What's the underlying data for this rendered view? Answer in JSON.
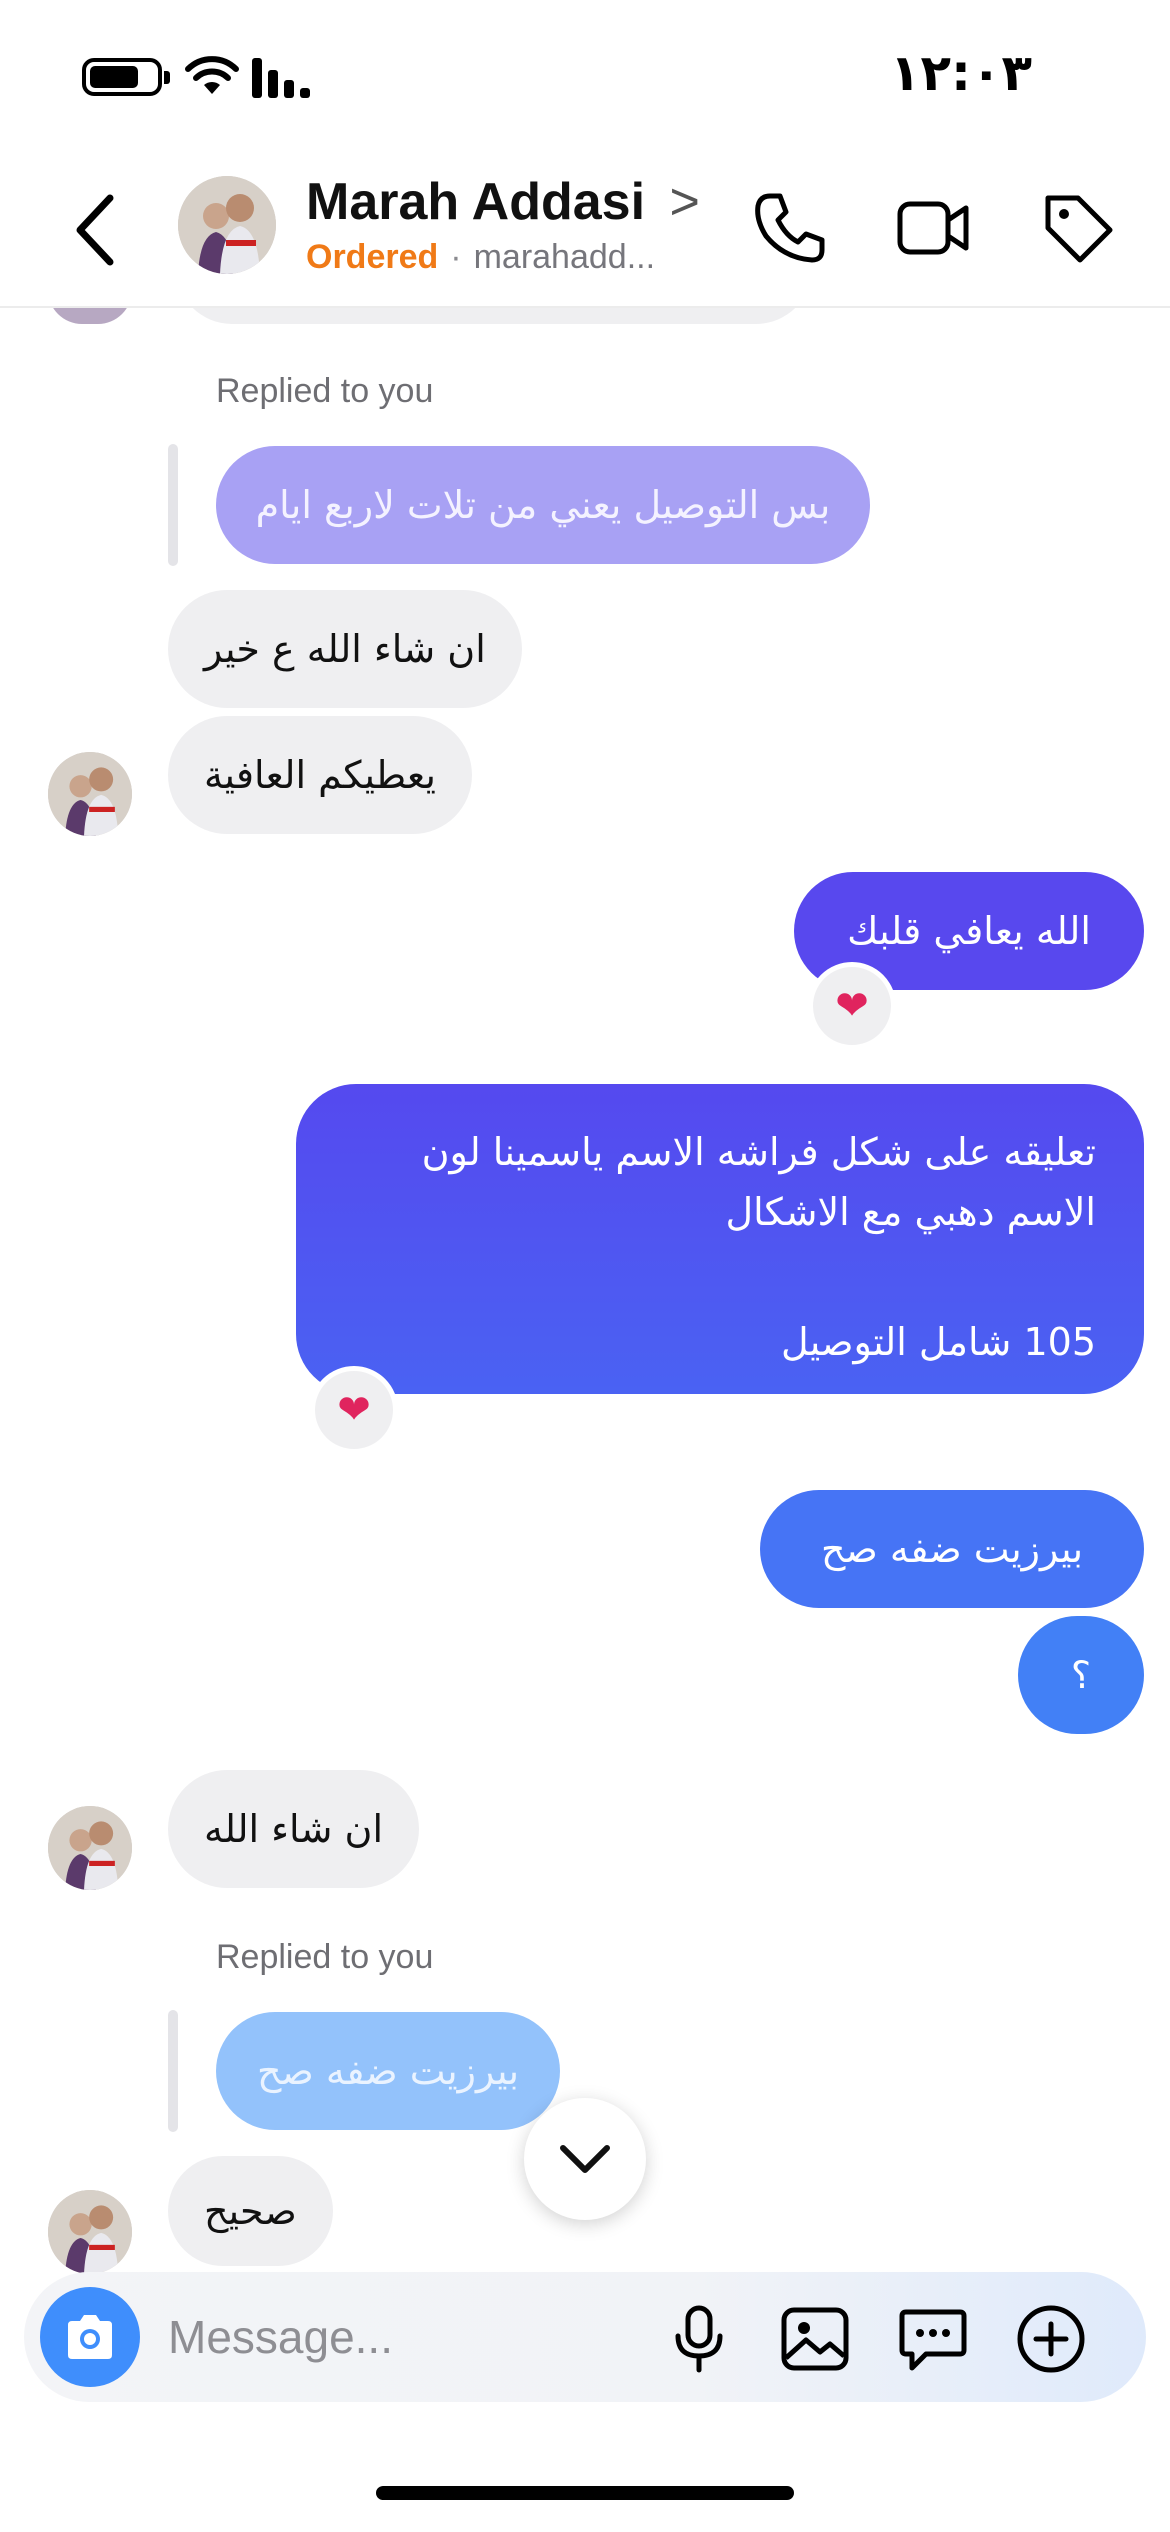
{
  "status_bar": {
    "time": "١٢:٠٣",
    "icons": [
      "battery-icon",
      "wifi-icon",
      "signal-icon"
    ]
  },
  "header": {
    "back_icon": "chevron-left-icon",
    "name": "Marah Addasi",
    "name_chevron": ">",
    "status": "Ordered",
    "separator": "·",
    "handle": "marahadd...",
    "actions": [
      "phone-icon",
      "video-icon",
      "tag-icon"
    ]
  },
  "messages": {
    "reply_label_1": "Replied to you",
    "quoted_1": "بس التوصيل يعني من تلات لاربع ايام",
    "in_1": "ان شاء الله ع خير",
    "in_2": "يعطيكم العافية",
    "out_1": "الله يعافي قلبك",
    "out_1_reaction": "❤",
    "out_2_line1": "تعليقه على شكل فراشه الاسم ياسمينا لون",
    "out_2_line2": "الاسم دهبي مع الاشكال",
    "out_2_line3": "105 شامل التوصيل",
    "out_2_reaction": "❤",
    "out_3": "بيرزيت ضفه صح",
    "out_4": "؟",
    "in_3": "ان شاء الله",
    "reply_label_2": "Replied to you",
    "quoted_2": "بيرزيت ضفه صح",
    "in_4": "صحيح"
  },
  "composer": {
    "placeholder": "Message...",
    "icons": [
      "camera-icon",
      "microphone-icon",
      "image-icon",
      "chat-bubble-icon",
      "plus-circle-icon"
    ]
  },
  "colors": {
    "accent_orange": "#f07a17",
    "bubble_in": "#efeff1",
    "bubble_out_top": "#5a4bf0",
    "bubble_out_bottom": "#3f86f6",
    "camera_blue": "#3f8efc"
  }
}
